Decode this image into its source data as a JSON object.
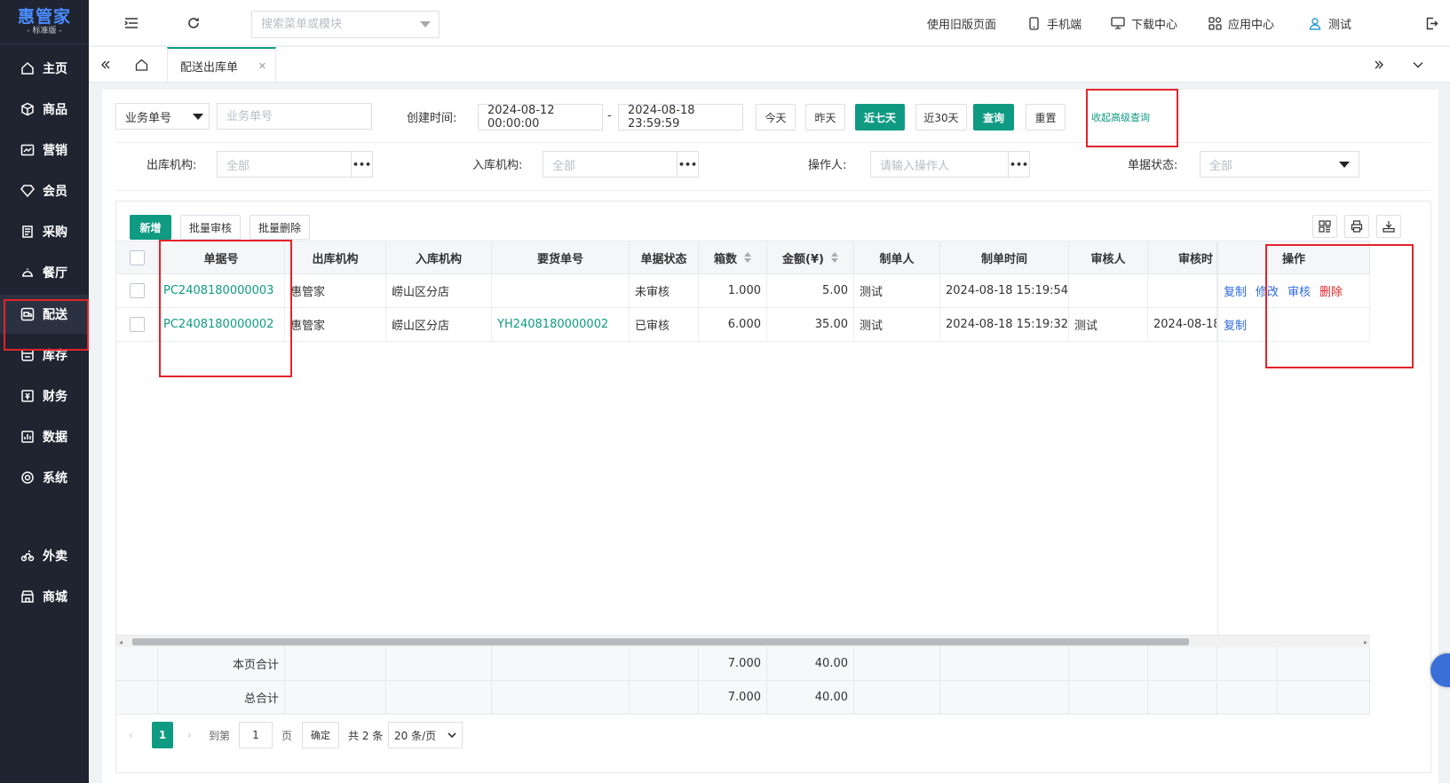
{
  "app": {
    "logo": "惠管家",
    "edition": "- 标准版 -"
  },
  "sidebar": {
    "items": [
      {
        "label": "主页",
        "icon": "home-icon"
      },
      {
        "label": "商品",
        "icon": "box-icon"
      },
      {
        "label": "营销",
        "icon": "chart-icon"
      },
      {
        "label": "会员",
        "icon": "diamond-icon"
      },
      {
        "label": "采购",
        "icon": "purchase-icon"
      },
      {
        "label": "餐厅",
        "icon": "dining-icon"
      },
      {
        "label": "配送",
        "icon": "delivery-icon",
        "active": true
      },
      {
        "label": "库存",
        "icon": "inventory-icon"
      },
      {
        "label": "财务",
        "icon": "finance-icon"
      },
      {
        "label": "数据",
        "icon": "data-icon"
      },
      {
        "label": "系统",
        "icon": "system-icon"
      },
      {
        "label": "外卖",
        "icon": "bike-icon"
      },
      {
        "label": "商城",
        "icon": "store-icon"
      }
    ]
  },
  "topbar": {
    "search_placeholder": "搜索菜单或模块",
    "links": {
      "old_version": "使用旧版页面",
      "mobile": "手机端",
      "download": "下载中心",
      "apps": "应用中心",
      "user": "测试"
    }
  },
  "tabs": {
    "active": "配送出库单"
  },
  "filters": {
    "biz_no_type": "业务单号",
    "biz_no_placeholder": "业务单号",
    "created_label": "创建时间:",
    "start": "2024-08-12 00:00:00",
    "sep": "-",
    "end": "2024-08-18 23:59:59",
    "today": "今天",
    "yesterday": "昨天",
    "last7": "近七天",
    "last30": "近30天",
    "query": "查询",
    "reset": "重置",
    "collapse_advanced": "收起高级查询",
    "out_org_label": "出库机构:",
    "out_org_value": "全部",
    "in_org_label": "入库机构:",
    "in_org_value": "全部",
    "operator_label": "操作人:",
    "operator_placeholder": "请输入操作人",
    "status_label": "单据状态:",
    "status_value": "全部"
  },
  "toolbar": {
    "add": "新增",
    "batch_audit": "批量审核",
    "batch_delete": "批量删除"
  },
  "table": {
    "headers": {
      "doc_no": "单据号",
      "out_org": "出库机构",
      "in_org": "入库机构",
      "req_no": "要货单号",
      "status": "单据状态",
      "boxes": "箱数",
      "amount": "金额(¥)",
      "creator": "制单人",
      "create_time": "制单时间",
      "auditor": "审核人",
      "audit_time": "审核时",
      "ops": "操作"
    },
    "rows": [
      {
        "doc_no": "PC2408180000003",
        "out_org": "惠管家",
        "in_org": "崂山区分店",
        "req_no": "",
        "status": "未审核",
        "boxes": "1.000",
        "amount": "5.00",
        "creator": "测试",
        "create_time": "2024-08-18 15:19:54",
        "auditor": "",
        "audit_time": "",
        "ops": [
          "复制",
          "修改",
          "审核",
          "删除"
        ]
      },
      {
        "doc_no": "PC2408180000002",
        "out_org": "惠管家",
        "in_org": "崂山区分店",
        "req_no": "YH2408180000002",
        "status": "已审核",
        "boxes": "6.000",
        "amount": "35.00",
        "creator": "测试",
        "create_time": "2024-08-18 15:19:32",
        "auditor": "测试",
        "audit_time": "2024-08-18",
        "ops": [
          "复制"
        ]
      }
    ],
    "footer": {
      "page_total": {
        "label": "本页合计",
        "boxes": "7.000",
        "amount": "40.00"
      },
      "grand_total": {
        "label": "总合计",
        "boxes": "7.000",
        "amount": "40.00"
      }
    }
  },
  "pagination": {
    "current": "1",
    "goto_label": "到第",
    "goto_value": "1",
    "page_unit": "页",
    "confirm": "确定",
    "total": "共 2 条",
    "per_page": "20 条/页"
  }
}
